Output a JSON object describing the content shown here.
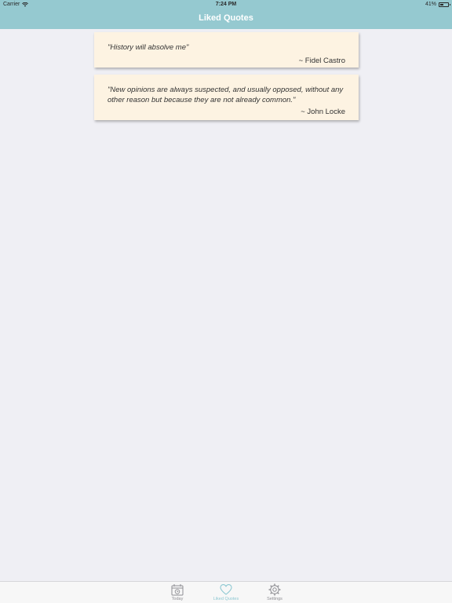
{
  "status_bar": {
    "carrier": "Carrier",
    "time": "7:24 PM",
    "battery": "41%"
  },
  "nav": {
    "title": "Liked Quotes"
  },
  "quotes": [
    {
      "text": "\"History will absolve me\"",
      "author": "~ Fidel Castro"
    },
    {
      "text": "\"New opinions are always suspected, and usually opposed, without any other reason but because they are not already common.\"",
      "author": "~ John Locke"
    }
  ],
  "tab_bar": {
    "items": [
      {
        "label": "Today",
        "icon": "calendar-icon",
        "active": false
      },
      {
        "label": "Liked Quotes",
        "icon": "heart-icon",
        "active": true
      },
      {
        "label": "Settings",
        "icon": "gear-icon",
        "active": false
      }
    ]
  },
  "colors": {
    "accent": "#95c9d0",
    "card_background": "#fdf3e2",
    "page_background": "#efeff4",
    "tab_active": "#8ec8d2",
    "tab_inactive": "#8e8e93"
  }
}
